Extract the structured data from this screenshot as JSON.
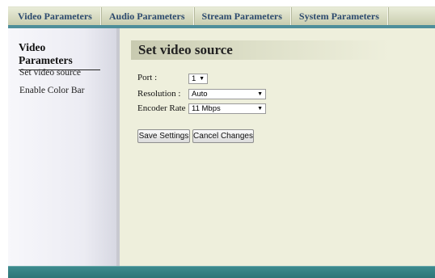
{
  "nav": {
    "tabs": [
      "Video Parameters",
      "Audio Parameters",
      "Stream Parameters",
      "System Parameters"
    ]
  },
  "sidebar": {
    "title": "Video Parameters",
    "items": [
      "Set video source",
      "Enable Color Bar"
    ]
  },
  "main": {
    "heading": "Set video source",
    "port": {
      "label": "Port :",
      "value": "1"
    },
    "resolution": {
      "label": "Resolution :",
      "value": "Auto"
    },
    "encoder_rate": {
      "label": "Encoder Rate :",
      "value": "11 Mbps"
    },
    "save_label": "Save Settings",
    "cancel_label": "Cancel Changes"
  },
  "colors": {
    "accent": "#4e8e9a",
    "nav_text": "#2c4a6e",
    "main_bg": "#eeefdc"
  }
}
